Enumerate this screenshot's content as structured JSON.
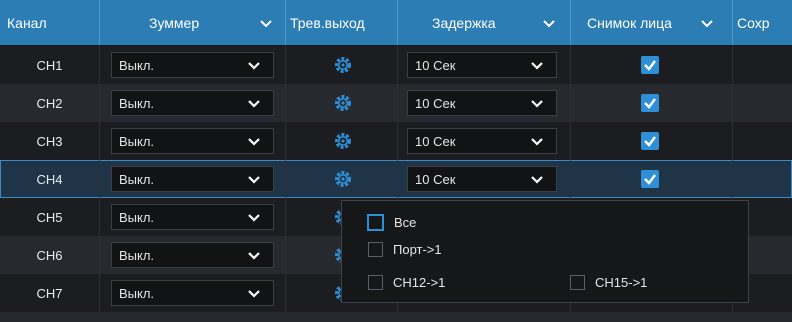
{
  "header": {
    "channel": "Канал",
    "buzzer": "Зуммер",
    "alarm_out": "Трев.выход",
    "delay": "Задержка",
    "face_snapshot": "Снимок лица",
    "save_partial": "Сохр"
  },
  "rows": [
    {
      "channel": "CH1",
      "buzzer": "Выкл.",
      "delay": "10 Сек",
      "face_snapshot": true
    },
    {
      "channel": "CH2",
      "buzzer": "Выкл.",
      "delay": "10 Сек",
      "face_snapshot": true
    },
    {
      "channel": "CH3",
      "buzzer": "Выкл.",
      "delay": "10 Сек",
      "face_snapshot": true
    },
    {
      "channel": "CH4",
      "buzzer": "Выкл.",
      "delay": "10 Сек",
      "face_snapshot": true
    },
    {
      "channel": "CH5",
      "buzzer": "Выкл."
    },
    {
      "channel": "CH6",
      "buzzer": "Выкл."
    },
    {
      "channel": "CH7",
      "buzzer": "Выкл."
    }
  ],
  "popup": {
    "all": "Все",
    "port": "Порт->1",
    "ch12": "CH12->1",
    "ch15": "CH15->1"
  },
  "colors": {
    "header_bg": "#2b7db3",
    "accent": "#2f8fd6",
    "selected_row": "#1f3547"
  }
}
